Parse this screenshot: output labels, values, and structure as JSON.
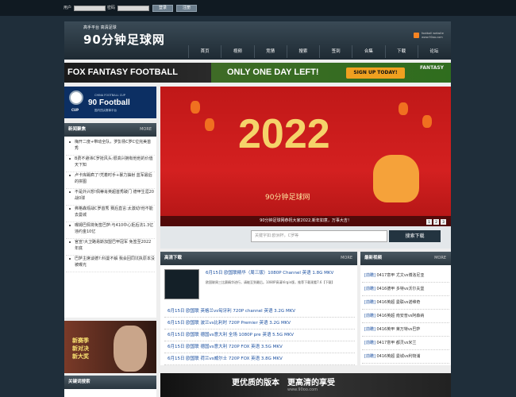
{
  "topbar": {
    "user_label": "用户",
    "pass_label": "密码",
    "login_label": "登录",
    "register_label": "注册"
  },
  "header": {
    "badge": "高手平台 高清足球",
    "logo": "90分钟足球网",
    "rss_text": "football website www.90oo.com",
    "nav": [
      "首页",
      "视频",
      "竞猜",
      "搜索",
      "签到",
      "合集",
      "下载",
      "论坛"
    ]
  },
  "fox_ad": {
    "brand": "FOX FANTASY FOOTBALL",
    "headline": "ONLY ONE DAY LEFT!",
    "cta": "SIGN UP TODAY!",
    "corner": "FANTASY"
  },
  "cup": {
    "top": "CHINA FOOTBALL CUP",
    "title": "90 Football",
    "sub": "国内顶尖赛事平台",
    "cup": "CUP"
  },
  "news": {
    "title": "新闻聚焦",
    "more": "MORE",
    "items": [
      "梅开二度+带动全队，罗彭扬C罗C位完美首秀",
      "B费不避讳C罗抢风头:很高兴拥有他他的价值天下知",
      "卢卡库踢疯了!凭着时手+暴力抽射 蓝军最后的拼图",
      "不是外兴想!佩蒂肖英超首秀破门 德甲生涯20战0球",
      "弗格森观战C罗首秀 赛后直言:太激动!他不能去曼城",
      "曝姆巴佩将免签巴萨:与410中心拒后法1.3亿 违约金10亿",
      "官宣!大卫路易斯加盟巴甲冠军 免签至2022年底",
      "巴萨主席谈德?:科曼不解 我会回同坑执原本没被曝光"
    ]
  },
  "banner": {
    "year": "2022",
    "site": "90分钟足球网",
    "caption": "90分钟足球网恭祝大家2022,新年如意，万事大吉！",
    "pages": [
      "1",
      "2",
      "3"
    ]
  },
  "search": {
    "placeholder": "关键字如:欧洲杯，C罗等",
    "button": "搜索下载"
  },
  "hd": {
    "title": "高清下载",
    "more": "MORE",
    "feature_title": "6月15日 欧国联精华（周三版）1080P Channel 英语 1.8G MKV",
    "feature_desc": "欧国联周三比赛精华进行，请能至到最后。1080P高清Virgin版，推荐下载观看7.6【下载】",
    "rows": [
      "6月15日 欧国联 英格兰vs匈牙利 720P channel 英语 3.2G MKV",
      "6月15日 欧国联 波兰vs比利时 720P Premier 英语 3.2G MKV",
      "6月15日 欧国联 德国vs意大利 全场 1080P pre 英语 5.5G MKV",
      "6月15日 欧国联 德国vs意大利 720P FOX 英语 3.5G MKV",
      "6月15日 欧国联 荷兰vs威尔士 720P FOX 英语 3.8G MKV"
    ]
  },
  "videos": {
    "title": "最新视频",
    "more": "MORE",
    "rows": [
      {
        "tag": "[前瞻]",
        "text": "0417意甲 尤文vs博洛尼亚"
      },
      {
        "tag": "[前瞻]",
        "text": "0416德甲 多特vs沃尔夫堡"
      },
      {
        "tag": "[前瞻]",
        "text": "0416英超 曼联vs诺维奇"
      },
      {
        "tag": "[前瞻]",
        "text": "0416英超 南安普vs阿森纳"
      },
      {
        "tag": "[前瞻]",
        "text": "0416英甲 莱万特vs巴萨"
      },
      {
        "tag": "[前瞻]",
        "text": "0417意甲 都灵vs米兰"
      },
      {
        "tag": "[前瞻]",
        "text": "0416英超 曼城vs利物浦"
      }
    ]
  },
  "beckham": {
    "line1": "新赛季",
    "line2": "新对决",
    "line3": "新大奖"
  },
  "keywords": {
    "title": "关键词搜索"
  },
  "strip": {
    "text": "更优质的版本　更高清的享受",
    "url": "www.90oo.com"
  }
}
